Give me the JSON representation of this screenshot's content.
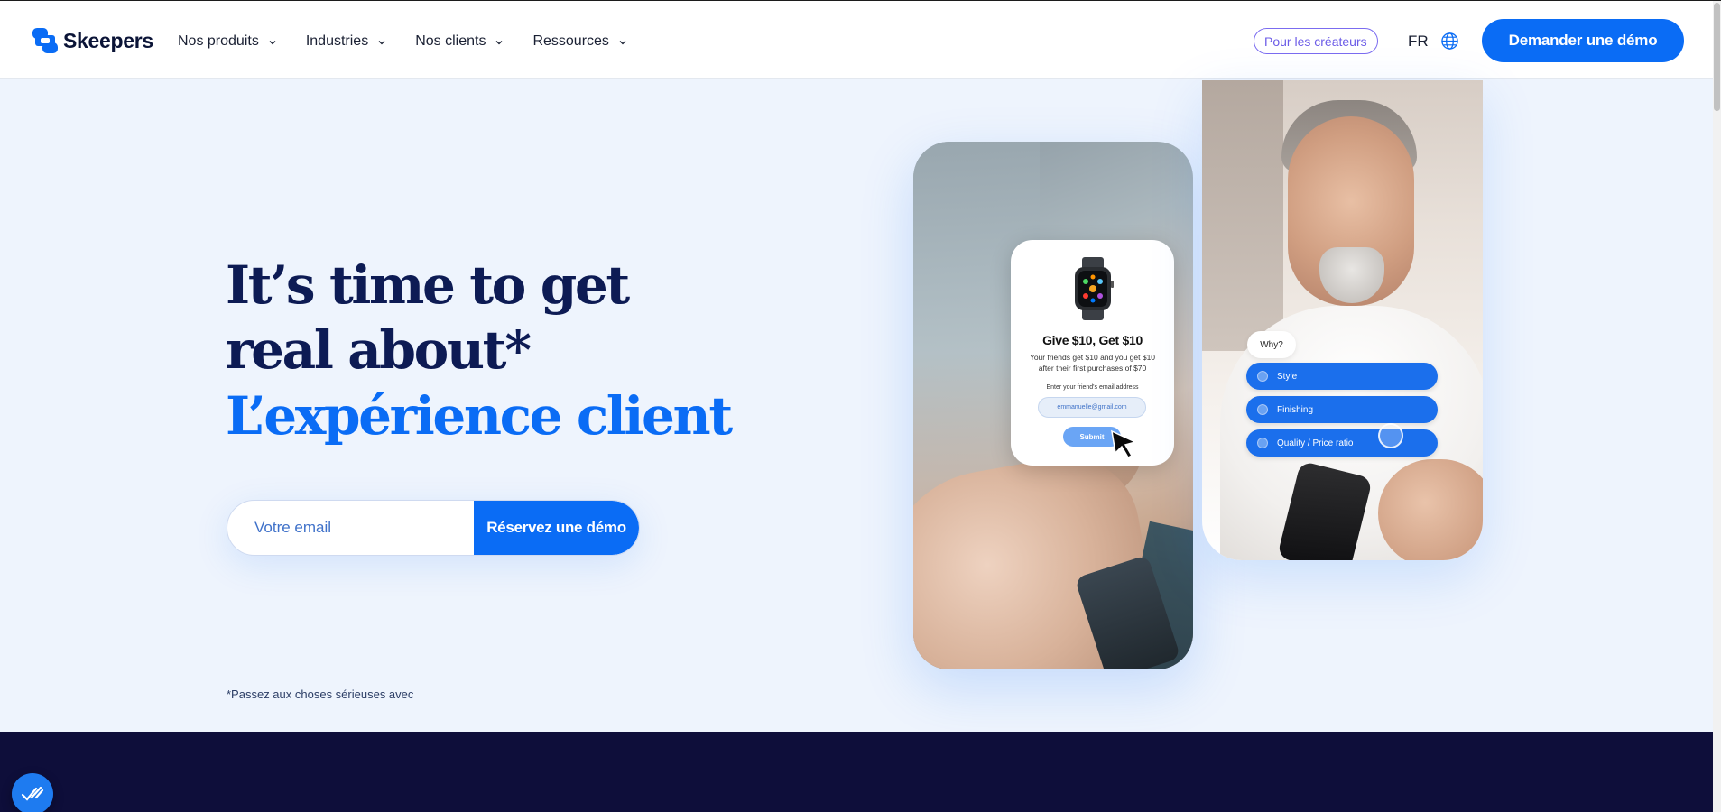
{
  "brand": {
    "name": "Skeepers",
    "accent": "#0a6cf5",
    "navy": "#0d1b54"
  },
  "nav": {
    "items": [
      {
        "label": "Nos produits"
      },
      {
        "label": "Industries"
      },
      {
        "label": "Nos clients"
      },
      {
        "label": "Ressources"
      }
    ],
    "creators_label": "Pour les créateurs",
    "language": "FR",
    "demo_label": "Demander une démo"
  },
  "hero": {
    "line1": "It’s time to get",
    "line2": "real about*",
    "line3": "L’expérience client",
    "email_placeholder": "Votre email",
    "submit_label": "Réservez une démo",
    "footnote": "*Passez aux choses sérieuses avec"
  },
  "referral_card": {
    "title": "Give $10, Get $10",
    "description": "Your friends get $10 and you get $10 after their first purchases of $70",
    "field_label": "Enter your friend's email address",
    "field_value": "emmanuelle@gmail.com",
    "submit_label": "Submit"
  },
  "survey": {
    "question": "Why?",
    "options": [
      {
        "label": "Style"
      },
      {
        "label": "Finishing"
      },
      {
        "label": "Quality / Price ratio"
      }
    ]
  },
  "icons": {
    "logo": "skeepers-logo-icon",
    "nav_chevron": "chevron-down-icon",
    "language": "globe-icon",
    "cursor": "cursor-pointer-icon",
    "chat": "chat-check-icon"
  }
}
